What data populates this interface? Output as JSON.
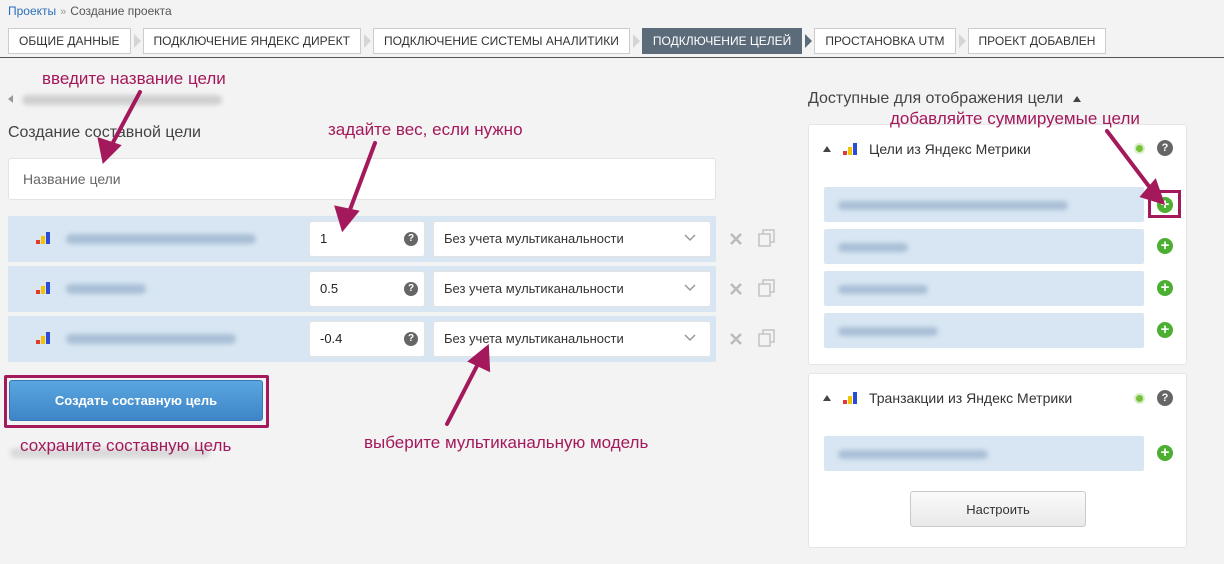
{
  "breadcrumb": {
    "root": "Проекты",
    "current": "Создание проекта"
  },
  "steps": [
    "ОБЩИЕ ДАННЫЕ",
    "ПОДКЛЮЧЕНИЕ ЯНДЕКС ДИРЕКТ",
    "ПОДКЛЮЧЕНИЕ СИСТЕМЫ АНАЛИТИКИ",
    "ПОДКЛЮЧЕНИЕ ЦЕЛЕЙ",
    "ПРОСТАНОВКА UTM",
    "ПРОЕКТ ДОБАВЛЕН"
  ],
  "active_step": 3,
  "composite": {
    "title": "Создание составной цели",
    "name_placeholder": "Название цели",
    "rows": [
      {
        "weight": "1",
        "model": "Без учета мультиканальности"
      },
      {
        "weight": "0.5",
        "model": "Без учета мультиканальности"
      },
      {
        "weight": "-0.4",
        "model": "Без учета мультиканальности"
      }
    ],
    "create_label": "Создать составную цель"
  },
  "available": {
    "title": "Доступные для отображения цели",
    "panel1_title": "Цели из Яндекс Метрики",
    "panel2_title": "Транзакции из Яндекс Метрики",
    "configure_label": "Настроить"
  },
  "annotations": {
    "enter_name": "введите название цели",
    "set_weight": "задайте вес, если нужно",
    "add_summed": "добавляйте суммируемые цели",
    "save": "сохраните составную цель",
    "choose_model": "выберите мультиканальную модель"
  },
  "colors": {
    "accent": "#a3195b",
    "active_step": "#5c6b7a",
    "primary_button": "#4a93d3",
    "goal_row": "#d8e6f3",
    "plus": "#4caf32"
  }
}
